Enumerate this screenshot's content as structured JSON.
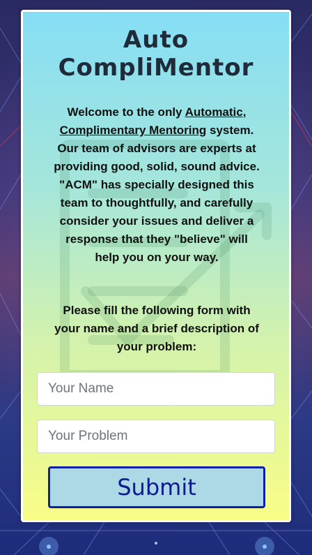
{
  "app": {
    "title_line1": "Auto",
    "title_line2": "CompliMentor"
  },
  "intro": {
    "part1": "Welcome to the only ",
    "link1": "Automatic",
    "part2": ", ",
    "link2": "Complimentary Mentoring",
    "part3": " system. Our team of advisors are experts at providing good, solid, sound advice. \"ACM\" has specially designed this team to thoughtfully, and carefully consider your issues and deliver a response that they \"believe\" will help you on your way."
  },
  "instructions": "Please fill the following form with your name and a brief description of your problem:",
  "form": {
    "name_placeholder": "Your Name",
    "name_value": "",
    "problem_placeholder": "Your Problem",
    "problem_value": "",
    "submit_label": "Submit"
  },
  "icons": {
    "background": "network-lines-graphic",
    "watermark": "checklist-icon"
  },
  "colors": {
    "card_top": "#86def5",
    "card_bottom": "#f8fd86",
    "button_bg": "#add8e6",
    "button_border": "#0e1fa8",
    "title_text": "#1f2b38"
  }
}
